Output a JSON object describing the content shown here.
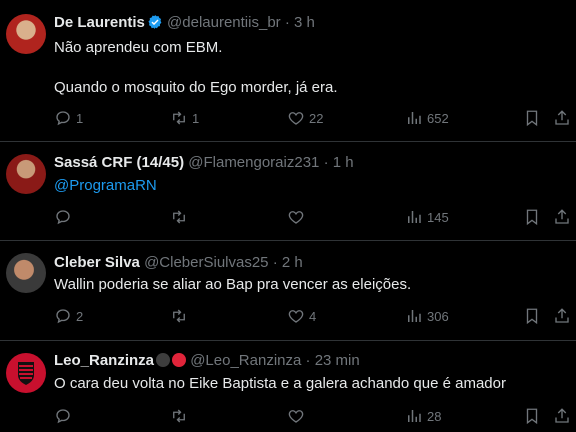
{
  "tweets": [
    {
      "name": "De Laurentis",
      "handle": "@delaurentiis_br",
      "time": "3 h",
      "verified": true,
      "lines": [
        "Não aprendeu com EBM.",
        "",
        "Quando o mosquito do Ego morder, já era."
      ],
      "replies": "1",
      "retweets": "1",
      "likes": "22",
      "views": "652"
    },
    {
      "name": "Sassá CRF (14/45)",
      "handle": "@Flamengoraiz231",
      "time": "1 h",
      "mention": "@ProgramaRN",
      "replies": "",
      "retweets": "",
      "likes": "",
      "views": "145"
    },
    {
      "name": "Cleber Silva",
      "handle": "@CleberSiulvas25",
      "time": "2 h",
      "text": "Wallin poderia se aliar ao Bap pra vencer as eleições.",
      "replies": "2",
      "retweets": "",
      "likes": "4",
      "views": "306"
    },
    {
      "name": "Leo_Ranzinza",
      "handle": "@Leo_Ranzinza",
      "time": "23 min",
      "text": "O cara deu volta no Eike Baptista e a galera achando que é amador",
      "replies": "",
      "retweets": "",
      "likes": "",
      "views": "28"
    }
  ],
  "separator": "·",
  "icons": [
    "reply-icon",
    "retweet-icon",
    "like-icon",
    "views-icon",
    "bookmark-icon",
    "share-icon",
    "verified-icon"
  ],
  "colors": {
    "background": "#000000",
    "text": "#e7e9ea",
    "muted": "#71767b",
    "link": "#1d9bf0",
    "verified": "#1d9bf0"
  }
}
